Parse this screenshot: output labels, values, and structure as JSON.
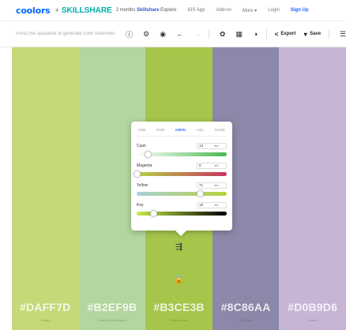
{
  "nav": {
    "logo": "coolors",
    "plus": "+",
    "partner": "SKILLSHARE",
    "promo_prefix": "2 months ",
    "promo_highlight": "Skillshare",
    "promo_suffix": " Explore",
    "links": [
      "iOS App",
      "Add-on",
      "More ▾",
      "Login"
    ],
    "signup": "Sign Up"
  },
  "toolbar": {
    "hint": "Press the spacebar to generate color schemes!",
    "export_label": "Export",
    "save_label": "Save"
  },
  "icons": {
    "hint_info": "ⓘ",
    "settings": "⚙",
    "camera": "◉",
    "undo": "←",
    "redo": "→",
    "adjust": "✿",
    "grid": "▦",
    "view": "◑",
    "share": "<",
    "heart": "♥",
    "menu": "☰",
    "sliders": "⇶",
    "lock": "🔒"
  },
  "palette": [
    {
      "hex": "#DAFF7D",
      "name": "Canary",
      "color": "#c5d979"
    },
    {
      "hex": "#B2EF9B",
      "name": "Granny Smith Apple",
      "color": "#b2d69e"
    },
    {
      "hex": "#B3CE3B",
      "name": "Yellow-Green",
      "color": "#a5c64b"
    },
    {
      "hex": "#8C86AA",
      "name": "Cool Grey",
      "color": "#8c88a9"
    },
    {
      "hex": "#D0B9D6",
      "name": "Thistle",
      "color": "#c8b5d4"
    }
  ],
  "popup": {
    "tabs": [
      "HSB",
      "RGB",
      "CMYK",
      "HSL",
      "NAME"
    ],
    "active_tab": "CMYK",
    "rows": [
      {
        "label": "Cyan",
        "value": "13",
        "level": 0.13,
        "gradient": "linear-gradient(90deg,#ffffff,#48b84a)"
      },
      {
        "label": "Magenta",
        "value": "0",
        "level": 0.0,
        "gradient": "linear-gradient(90deg,#b4d246,#c9335e)"
      },
      {
        "label": "Yellow",
        "value": "71",
        "level": 0.71,
        "gradient": "linear-gradient(90deg,#a8d0d8,#b6d23a)"
      },
      {
        "label": "Key",
        "value": "19",
        "level": 0.19,
        "gradient": "linear-gradient(90deg,#c7ef45,#000000)"
      }
    ],
    "stepper_arrows": "◂ ▸"
  }
}
